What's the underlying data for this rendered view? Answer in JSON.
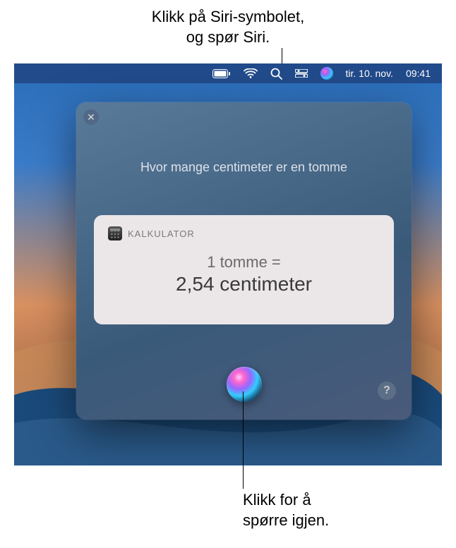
{
  "callout_top": {
    "line1": "Klikk på Siri-symbolet,",
    "line2": "og spør Siri."
  },
  "menubar": {
    "date": "tir. 10. nov.",
    "time": "09:41"
  },
  "siri": {
    "query": "Hvor mange centimeter er en tomme",
    "card": {
      "app_label": "KALKULATOR",
      "line1": "1 tomme =",
      "line2": "2,54 centimeter"
    },
    "help": "?",
    "close": "✕"
  },
  "callout_bottom": {
    "line1": "Klikk for å",
    "line2": "spørre igjen."
  }
}
